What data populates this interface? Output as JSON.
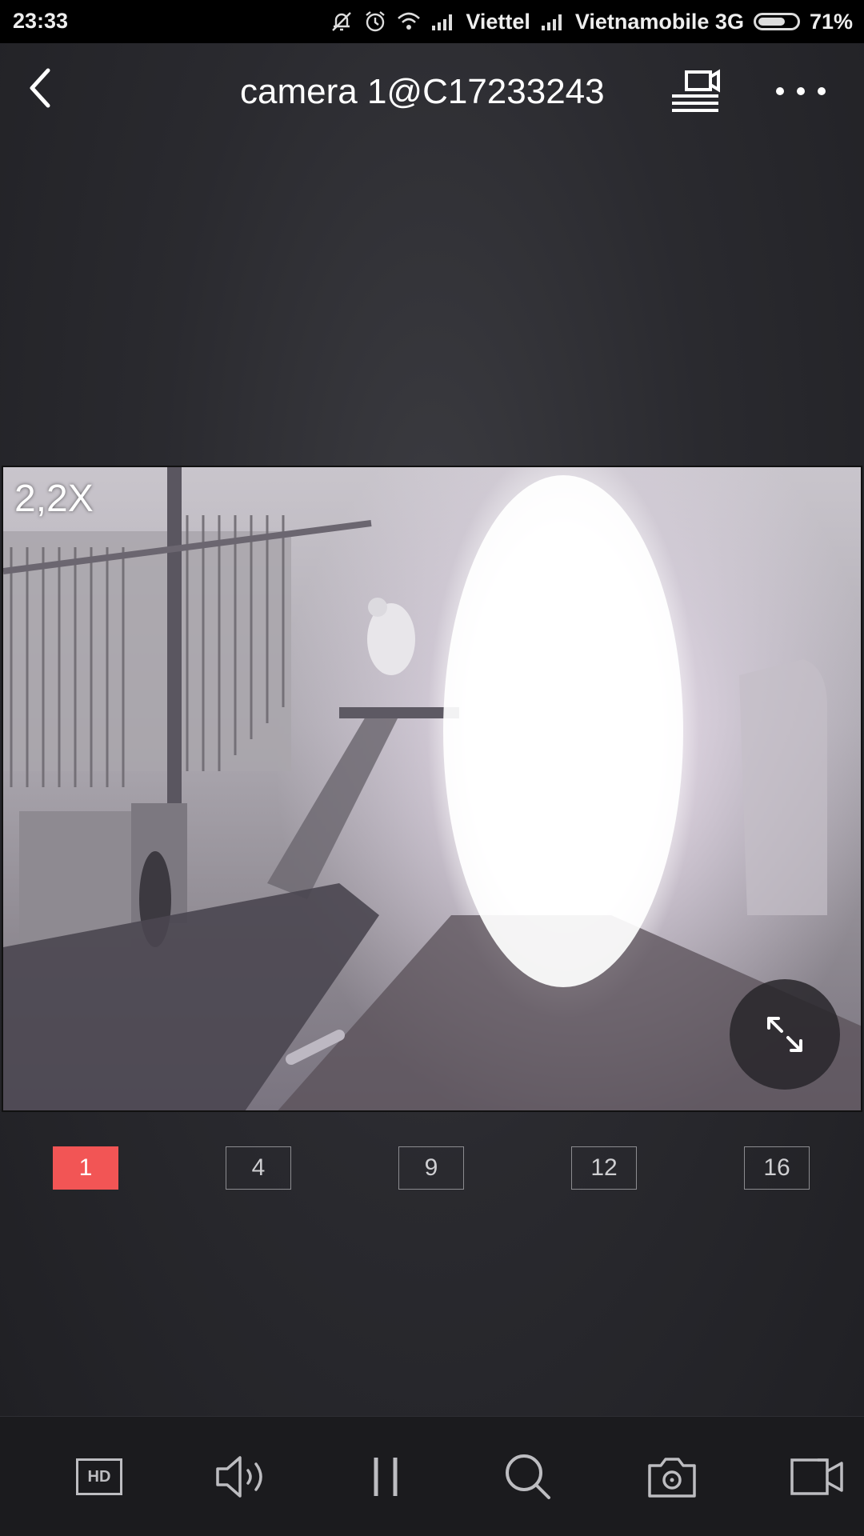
{
  "status_bar": {
    "time": "23:33",
    "carrier_1": "Viettel",
    "carrier_2": "Vietnamobile 3G",
    "battery": "71%",
    "battery_level": 0.71
  },
  "header": {
    "title": "camera 1@C17233243",
    "back_icon": "chevron-left-icon",
    "record_list_icon": "playback-list-icon",
    "more_icon": "more-dots-icon"
  },
  "video": {
    "zoom_label": "2,2X",
    "fullscreen_icon": "expand-arrows-icon"
  },
  "layout_options": {
    "opt_1": "1",
    "opt_4": "4",
    "opt_9": "9",
    "opt_12": "12",
    "opt_16": "16",
    "selected": "1",
    "accent_color": "#f25555"
  },
  "toolbar": {
    "hd_label": "HD",
    "tools": [
      "hd-quality-icon",
      "speaker-icon",
      "pause-icon",
      "search-zoom-icon",
      "camera-snapshot-icon",
      "video-record-icon"
    ]
  }
}
